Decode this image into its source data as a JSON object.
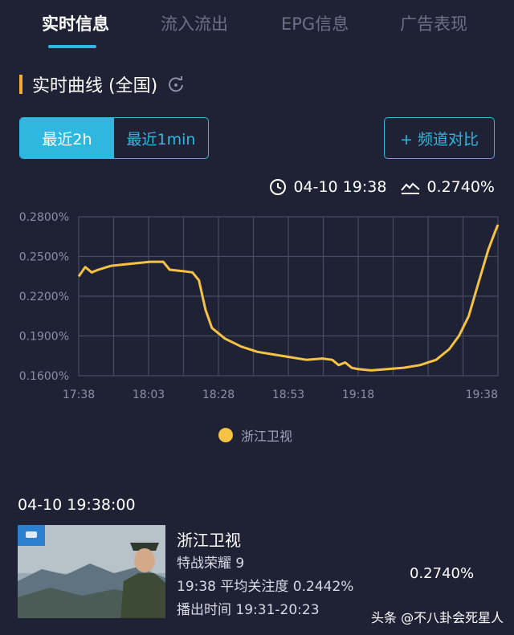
{
  "tabs": [
    {
      "label": "实时信息",
      "active": true
    },
    {
      "label": "流入流出",
      "active": false
    },
    {
      "label": "EPG信息",
      "active": false
    },
    {
      "label": "广告表现",
      "active": false
    }
  ],
  "section": {
    "title": "实时曲线 (全国)",
    "refresh_icon": "refresh-icon"
  },
  "range_toggle": {
    "options": [
      "最近2h",
      "最近1min"
    ],
    "selected": "最近2h"
  },
  "compare_button": "+ 频道对比",
  "readout": {
    "time": "04-10 19:38",
    "value": "0.2740%",
    "time_icon": "clock-icon",
    "value_icon": "trend-icon"
  },
  "chart_data": {
    "type": "line",
    "x_ticks": [
      "17:38",
      "18:03",
      "18:28",
      "18:53",
      "19:18",
      "19:38"
    ],
    "y_ticks": [
      "0.2800%",
      "0.2500%",
      "0.2200%",
      "0.1900%",
      "0.1600%"
    ],
    "ylim": [
      0.16,
      0.28
    ],
    "grid": true,
    "legend_position": "bottom-center",
    "series": [
      {
        "name": "浙江卫视",
        "color": "#f5c244",
        "points": [
          [
            0,
            0.235
          ],
          [
            2,
            0.242
          ],
          [
            4,
            0.238
          ],
          [
            6,
            0.24
          ],
          [
            10,
            0.243
          ],
          [
            14,
            0.244
          ],
          [
            18,
            0.245
          ],
          [
            22,
            0.246
          ],
          [
            26,
            0.246
          ],
          [
            28,
            0.24
          ],
          [
            32,
            0.239
          ],
          [
            35,
            0.238
          ],
          [
            37,
            0.232
          ],
          [
            39,
            0.21
          ],
          [
            41,
            0.196
          ],
          [
            45,
            0.188
          ],
          [
            50,
            0.182
          ],
          [
            55,
            0.178
          ],
          [
            60,
            0.176
          ],
          [
            65,
            0.174
          ],
          [
            70,
            0.172
          ],
          [
            75,
            0.173
          ],
          [
            78,
            0.172
          ],
          [
            80,
            0.168
          ],
          [
            82,
            0.17
          ],
          [
            84,
            0.166
          ],
          [
            86,
            0.165
          ],
          [
            90,
            0.164
          ],
          [
            95,
            0.165
          ],
          [
            100,
            0.166
          ],
          [
            105,
            0.168
          ],
          [
            110,
            0.172
          ],
          [
            114,
            0.18
          ],
          [
            117,
            0.19
          ],
          [
            120,
            0.205
          ],
          [
            123,
            0.23
          ],
          [
            126,
            0.255
          ],
          [
            128,
            0.268
          ],
          [
            129,
            0.274
          ]
        ]
      }
    ]
  },
  "legend": {
    "label": "浙江卫视"
  },
  "program": {
    "timestamp": "04-10 19:38:00",
    "channel": "浙江卫视",
    "title": "特战荣耀 9",
    "avg_attention": "19:38 平均关注度 0.2442%",
    "air_time": "播出时间 19:31-20:23",
    "current_value": "0.2740%"
  },
  "watermark": "头条 @不八卦会死星人"
}
